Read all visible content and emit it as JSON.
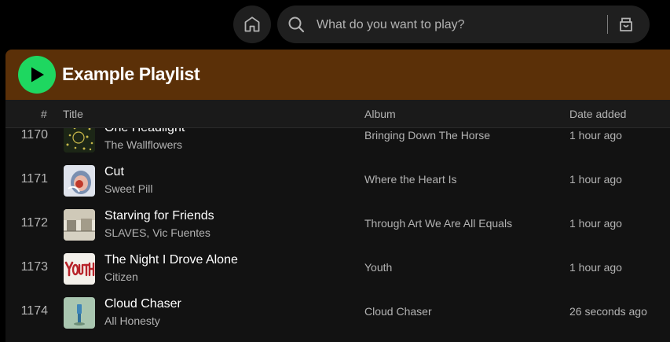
{
  "search": {
    "placeholder": "What do you want to play?"
  },
  "playlist": {
    "title": "Example Playlist",
    "header_color": "#5b3008",
    "accent": "#1ed760"
  },
  "columns": {
    "number": "#",
    "title": "Title",
    "album": "Album",
    "date_added": "Date added"
  },
  "tracks": [
    {
      "number": "1170",
      "title": "One Headlight",
      "artist": "The Wallflowers",
      "album": "Bringing Down The Horse",
      "date_added": "1 hour ago",
      "art": "dots-art"
    },
    {
      "number": "1171",
      "title": "Cut",
      "artist": "Sweet Pill",
      "album": "Where the Heart Is",
      "date_added": "1 hour ago",
      "art": "face-art"
    },
    {
      "number": "1172",
      "title": "Starving for Friends",
      "artist": "SLAVES, Vic Fuentes",
      "album": "Through Art We Are All Equals",
      "date_added": "1 hour ago",
      "art": "street-art"
    },
    {
      "number": "1173",
      "title": "The Night I Drove Alone",
      "artist": "Citizen",
      "album": "Youth",
      "date_added": "1 hour ago",
      "art": "youth-art"
    },
    {
      "number": "1174",
      "title": "Cloud Chaser",
      "artist": "All Honesty",
      "album": "Cloud Chaser",
      "date_added": "26 seconds ago",
      "art": "cloud-art"
    }
  ],
  "icons": {
    "home": "home-icon",
    "search": "search-icon",
    "browse": "browse-icon",
    "play": "play-icon"
  }
}
